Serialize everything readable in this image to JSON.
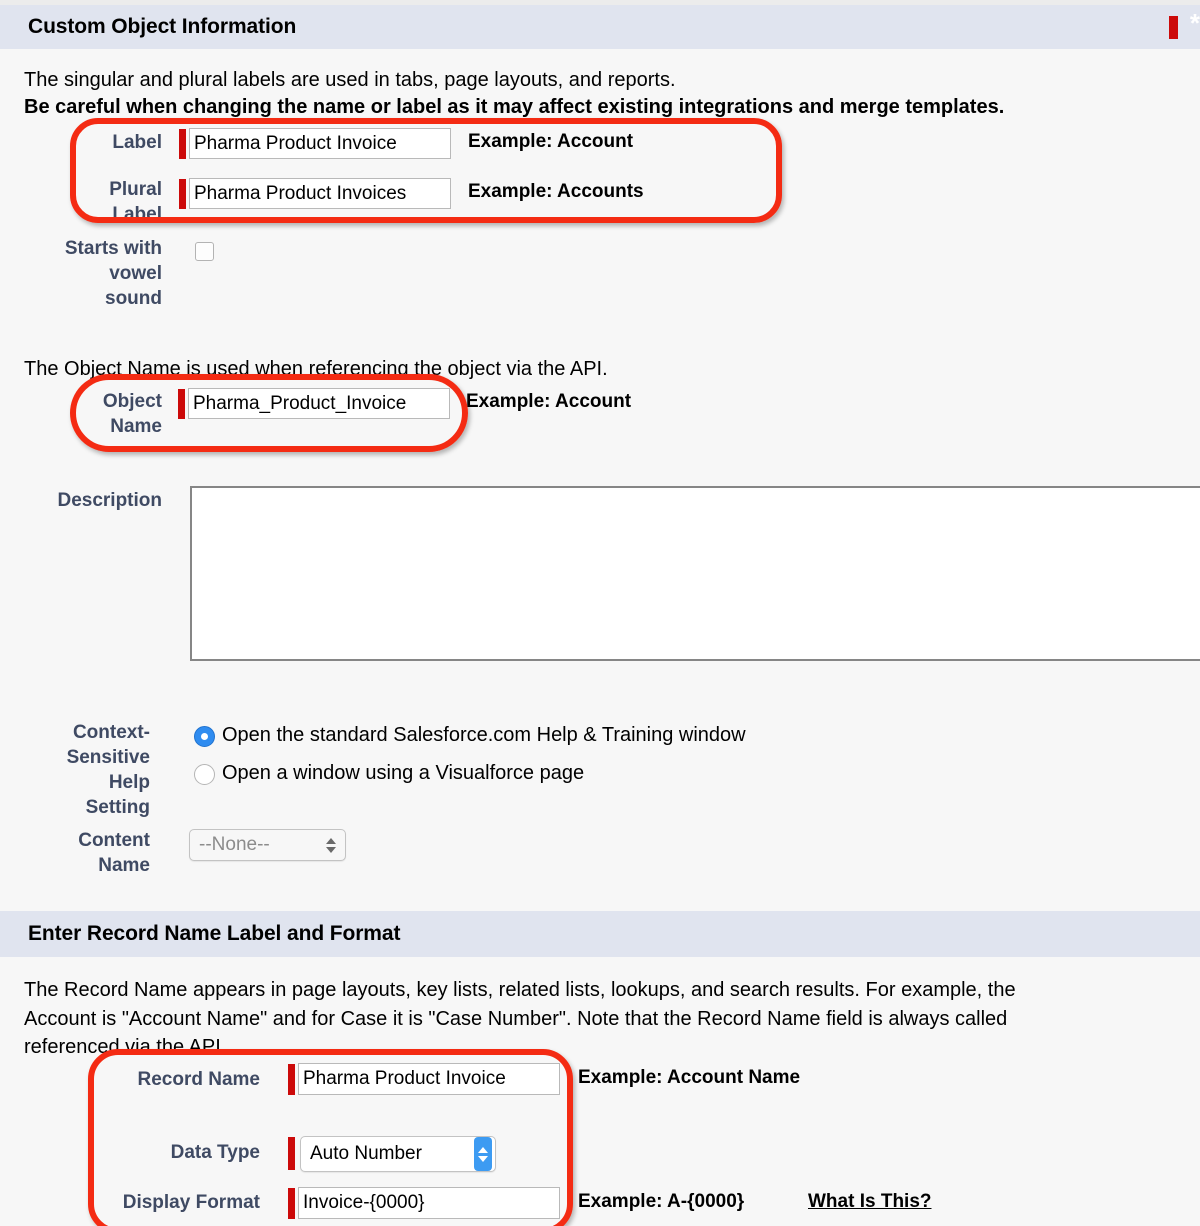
{
  "sections": {
    "custom_object": {
      "title": "Custom Object Information",
      "required_asterisk": "*",
      "intro_line1": "The singular and plural labels are used in tabs, page layouts, and reports.",
      "intro_line2": "Be careful when changing the name or label as it may affect existing integrations and merge templates.",
      "api_note": "The Object Name is used when referencing the object via the API.",
      "fields": {
        "label": {
          "label": "Label",
          "value": "Pharma Product Invoice",
          "example": "Example:  Account"
        },
        "plural_label": {
          "label_line1": "Plural",
          "label_line2": "Label",
          "value": "Pharma Product Invoices",
          "example": "Example:  Accounts"
        },
        "vowel": {
          "label_line1": "Starts with",
          "label_line2": "vowel",
          "label_line3": "sound",
          "checked": false
        },
        "object_name": {
          "label_line1": "Object",
          "label_line2": "Name",
          "value": "Pharma_Product_Invoice",
          "example": "Example:  Account"
        },
        "description": {
          "label": "Description",
          "value": "",
          "placeholder": ""
        },
        "help_setting": {
          "label_line1": "Context-",
          "label_line2": "Sensitive",
          "label_line3": "Help",
          "label_line4": "Setting",
          "option_standard": "Open the standard Salesforce.com Help & Training window",
          "option_visualforce": "Open a window using a Visualforce page",
          "selected": "standard"
        },
        "content_name": {
          "label_line1": "Content",
          "label_line2": "Name",
          "value": "--None--",
          "disabled": true
        }
      }
    },
    "record_name": {
      "title": "Enter Record Name Label and Format",
      "intro_line1": "The Record Name appears in page layouts, key lists, related lists, lookups, and search results. For example, the",
      "intro_line2": "Account is \"Account Name\" and for Case it is \"Case Number\". Note that the Record Name field is always called",
      "intro_line3": "referenced via the API.",
      "fields": {
        "record_name": {
          "label": "Record Name",
          "value": "Pharma Product Invoice",
          "example": "Example:  Account Name"
        },
        "data_type": {
          "label": "Data Type",
          "value": "Auto Number"
        },
        "display_format": {
          "label": "Display Format",
          "value": "Invoice-{0000}",
          "example": "Example:  A-{0000}",
          "help_link": "What Is This?"
        }
      }
    }
  },
  "colors": {
    "band_background": "#e0e4ef",
    "required_red": "#cc0a0a",
    "annotation_red": "#f42b13",
    "label_text": "#3f4a63",
    "page_background": "#f7f7f7",
    "radio_selected": "#2f8cf0",
    "stepper_blue": "#3d9bf2"
  }
}
